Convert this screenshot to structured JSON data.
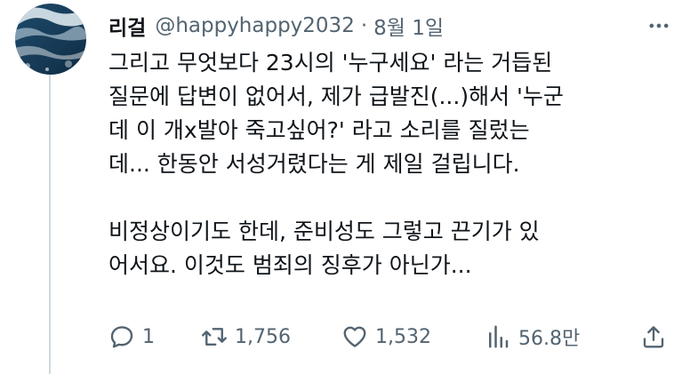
{
  "tweet": {
    "author": {
      "display_name": "리걸",
      "handle": "@happyhappy2032",
      "separator": "·",
      "date": "8월 1일"
    },
    "paragraphs": [
      [
        "그리고 무엇보다 23시의 '누구세요' 라는 거듭된",
        "질문에 답변이 없어서, 제가 급발진(...)해서 '누군",
        "데 이 개x발아 죽고싶어?' 라고 소리를 질렀는",
        "데... 한동안 서성거렸다는 게 제일 걸립니다."
      ],
      [
        "비정상이기도 한데, 준비성도 그렇고 끈기가 있",
        "어서요. 이것도 범죄의 징후가 아닌가..."
      ]
    ],
    "actions": {
      "reply": {
        "icon": "reply-icon",
        "count": "1"
      },
      "retweet": {
        "icon": "retweet-icon",
        "count": "1,756"
      },
      "like": {
        "icon": "heart-icon",
        "count": "1,532"
      },
      "views": {
        "icon": "views-chart-icon",
        "count": "56.8만"
      },
      "share": {
        "icon": "share-icon"
      }
    }
  },
  "colors": {
    "text_primary": "#0f1419",
    "text_secondary": "#536471",
    "thread_line": "#cfd9de",
    "avatar_sea_dark": "#163a55",
    "avatar_foam": "#e8f1f6"
  }
}
